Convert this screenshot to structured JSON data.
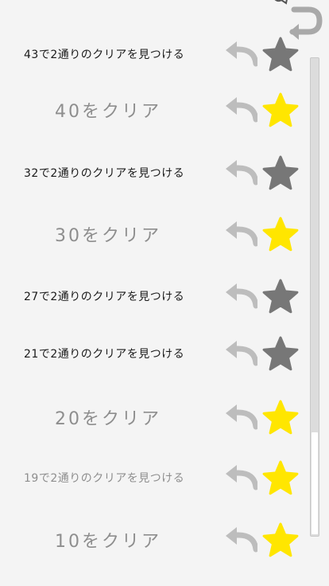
{
  "header": {
    "back_icon": "undo-arrow-icon"
  },
  "rows": [
    {
      "label": "43で2通りのクリアを見つける",
      "star": "gray",
      "style": "small"
    },
    {
      "label": "40をクリア",
      "star": "yellow",
      "style": "large"
    },
    {
      "label": "32で2通りのクリアを見つける",
      "star": "gray",
      "style": "small"
    },
    {
      "label": "30をクリア",
      "star": "yellow",
      "style": "large"
    },
    {
      "label": "27で2通りのクリアを見つける",
      "star": "gray",
      "style": "small"
    },
    {
      "label": "21で2通りのクリアを見つける",
      "star": "gray",
      "style": "small"
    },
    {
      "label": "20をクリア",
      "star": "yellow",
      "style": "large"
    },
    {
      "label": "19で2通りのクリアを見つける",
      "star": "yellow",
      "style": "small-muted"
    },
    {
      "label": "10をクリア",
      "star": "yellow",
      "style": "large"
    }
  ],
  "colors": {
    "background": "#f4f4f4",
    "star_earned": "#ffe600",
    "star_unearned": "#777777",
    "undo_arrow": "#bdbdbd",
    "header_arrow": "#a9a9a9",
    "text_dark": "#1a1a1a",
    "text_muted": "#8e8e8e"
  },
  "scroll": {
    "position_fraction": 0.95
  }
}
